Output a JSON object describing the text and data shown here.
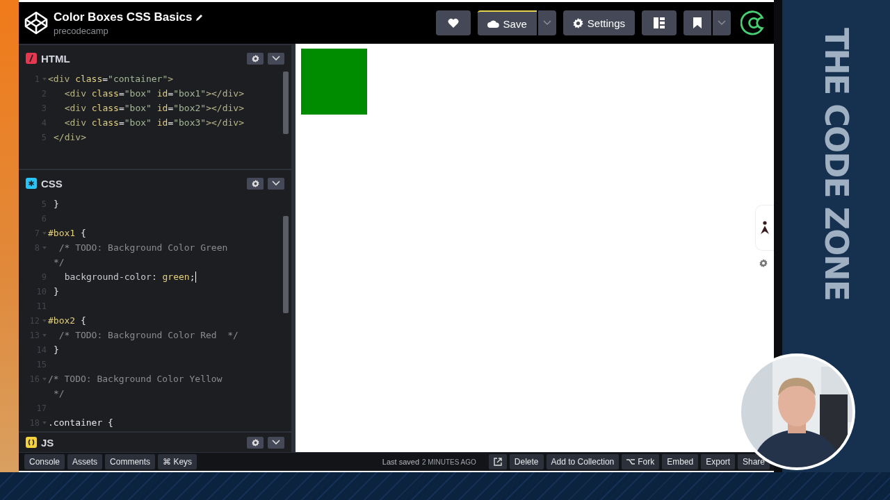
{
  "header": {
    "title": "Color Boxes CSS Basics",
    "author": "precodecamp",
    "save_label": "Save",
    "settings_label": "Settings"
  },
  "panels": [
    {
      "kind": "html",
      "name": "HTML",
      "lines": [
        {
          "number": "1",
          "fold": true,
          "tokens": [
            {
              "t": "<div",
              "kind": "tag"
            },
            {
              "t": " class",
              "kind": "attr"
            },
            {
              "t": "=",
              "kind": "punct"
            },
            {
              "t": "\"container\"",
              "kind": "string"
            },
            {
              "t": ">",
              "kind": "tag"
            }
          ]
        },
        {
          "number": "2",
          "fold": false,
          "tokens": [
            {
              "t": "  <div",
              "kind": "tag"
            },
            {
              "t": " class",
              "kind": "attr"
            },
            {
              "t": "=",
              "kind": "punct"
            },
            {
              "t": "\"box\"",
              "kind": "string"
            },
            {
              "t": " id",
              "kind": "attr"
            },
            {
              "t": "=",
              "kind": "punct"
            },
            {
              "t": "\"box1\"",
              "kind": "string"
            },
            {
              "t": "></div>",
              "kind": "tag"
            }
          ]
        },
        {
          "number": "3",
          "fold": false,
          "tokens": [
            {
              "t": "  <div",
              "kind": "tag"
            },
            {
              "t": " class",
              "kind": "attr"
            },
            {
              "t": "=",
              "kind": "punct"
            },
            {
              "t": "\"box\"",
              "kind": "string"
            },
            {
              "t": " id",
              "kind": "attr"
            },
            {
              "t": "=",
              "kind": "punct"
            },
            {
              "t": "\"box2\"",
              "kind": "string"
            },
            {
              "t": "></div>",
              "kind": "tag"
            }
          ]
        },
        {
          "number": "4",
          "fold": false,
          "tokens": [
            {
              "t": "  <div",
              "kind": "tag"
            },
            {
              "t": " class",
              "kind": "attr"
            },
            {
              "t": "=",
              "kind": "punct"
            },
            {
              "t": "\"box\"",
              "kind": "string"
            },
            {
              "t": " id",
              "kind": "attr"
            },
            {
              "t": "=",
              "kind": "punct"
            },
            {
              "t": "\"box3\"",
              "kind": "string"
            },
            {
              "t": "></div>",
              "kind": "tag"
            }
          ]
        },
        {
          "number": "5",
          "fold": false,
          "tokens": [
            {
              "t": "</div>",
              "kind": "tag"
            }
          ]
        }
      ]
    },
    {
      "kind": "css",
      "name": "CSS",
      "lines": [
        {
          "number": "5",
          "fold": false,
          "tokens": [
            {
              "t": "}",
              "kind": "punct"
            }
          ]
        },
        {
          "number": "6",
          "fold": false
        },
        {
          "number": "7",
          "fold": true,
          "tokens": [
            {
              "t": "#box1",
              "kind": "selector"
            },
            {
              "t": " {",
              "kind": "punct"
            }
          ]
        },
        {
          "number": "8",
          "fold": true,
          "tokens": [
            {
              "t": "  /* TODO: Background Color Green",
              "kind": "comment"
            }
          ]
        },
        {
          "fold": false,
          "tokens": [
            {
              "t": "*/",
              "kind": "comment"
            }
          ]
        },
        {
          "number": "9",
          "fold": false,
          "cursor": true,
          "tokens": [
            {
              "t": "  background-color",
              "kind": "property"
            },
            {
              "t": ": ",
              "kind": "punct"
            },
            {
              "t": "green",
              "kind": "value"
            },
            {
              "t": ";",
              "kind": "punct"
            }
          ]
        },
        {
          "number": "10",
          "fold": false,
          "tokens": [
            {
              "t": "}",
              "kind": "punct"
            }
          ]
        },
        {
          "number": "11",
          "fold": false
        },
        {
          "number": "12",
          "fold": true,
          "tokens": [
            {
              "t": "#box2",
              "kind": "selector"
            },
            {
              "t": " {",
              "kind": "punct"
            }
          ]
        },
        {
          "number": "13",
          "fold": true,
          "tokens": [
            {
              "t": "  /* TODO: Background Color Red  */",
              "kind": "comment"
            }
          ]
        },
        {
          "number": "14",
          "fold": false,
          "tokens": [
            {
              "t": "}",
              "kind": "punct"
            }
          ]
        },
        {
          "number": "15",
          "fold": false
        },
        {
          "number": "16",
          "fold": true,
          "tokens": [
            {
              "t": "/* TODO: Background Color Yellow",
              "kind": "comment"
            }
          ]
        },
        {
          "fold": false,
          "tokens": [
            {
              "t": "*/",
              "kind": "comment"
            }
          ]
        },
        {
          "number": "17",
          "fold": false
        },
        {
          "number": "18",
          "fold": true,
          "tokens": [
            {
              "t": ".container",
              "kind": "punct"
            },
            {
              "t": " {",
              "kind": "punct"
            }
          ]
        }
      ]
    },
    {
      "kind": "js",
      "name": "JS"
    }
  ],
  "footer": {
    "left_buttons": [
      "Console",
      "Assets",
      "Comments",
      "⌘ Keys"
    ],
    "last_saved": "Last saved",
    "saved_time": "2 MINUTES AGO",
    "right_buttons": [
      {
        "kind": "external"
      },
      {
        "kind": "text",
        "label": "Delete"
      },
      {
        "kind": "text",
        "label": "Add to Collection"
      },
      {
        "kind": "fork",
        "label": "Fork"
      },
      {
        "kind": "text",
        "label": "Embed"
      },
      {
        "kind": "text",
        "label": "Export"
      },
      {
        "kind": "text",
        "label": "Share"
      }
    ]
  },
  "branding": "THE CODE ZONE"
}
